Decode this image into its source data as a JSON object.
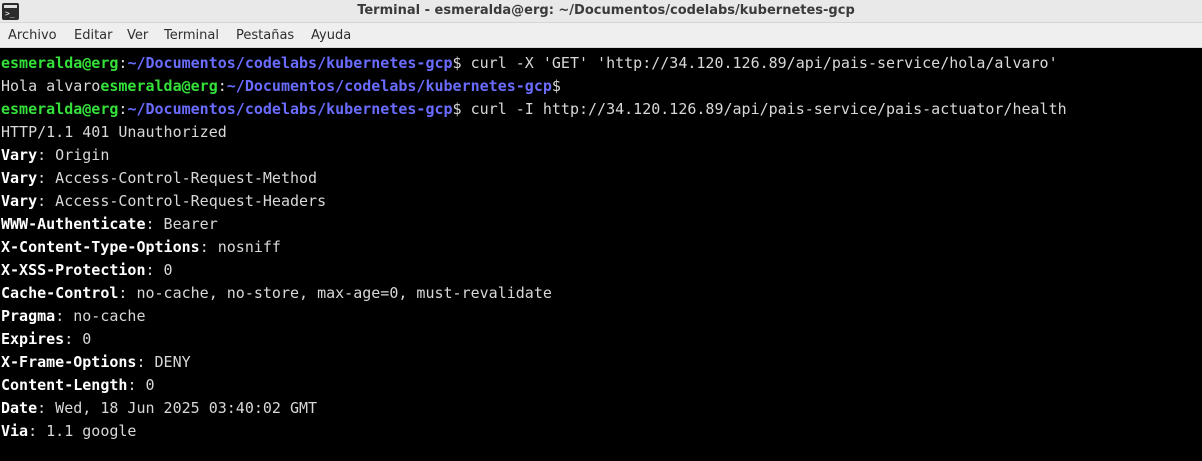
{
  "window": {
    "title": "Terminal - esmeralda@erg: ~/Documentos/codelabs/kubernetes-gcp",
    "icon": "terminal-app-icon"
  },
  "menubar": {
    "items": [
      "Archivo",
      "Editar",
      "Ver",
      "Terminal",
      "Pestañas",
      "Ayuda"
    ]
  },
  "prompt": {
    "user_host": "esmeralda@erg",
    "colon": ":",
    "path": "~/Documentos/codelabs/kubernetes-gcp",
    "dollar": "$"
  },
  "colors": {
    "background": "#000000",
    "prompt_user": "#34e03a",
    "prompt_path": "#6a6cff",
    "text": "#d8d8d8"
  },
  "terminal": {
    "cmd1": " curl -X 'GET' 'http://34.120.126.89/api/pais-service/hola/alvaro'",
    "output1": "Hola alvaro",
    "cmd2": "",
    "cmd3": " curl -I http://34.120.126.89/api/pais-service/pais-actuator/health",
    "status_line": "HTTP/1.1 401 Unauthorized",
    "headers": [
      {
        "key": "Vary",
        "value": ": Origin"
      },
      {
        "key": "Vary",
        "value": ": Access-Control-Request-Method"
      },
      {
        "key": "Vary",
        "value": ": Access-Control-Request-Headers"
      },
      {
        "key": "WWW-Authenticate",
        "value": ": Bearer"
      },
      {
        "key": "X-Content-Type-Options",
        "value": ": nosniff"
      },
      {
        "key": "X-XSS-Protection",
        "value": ": 0"
      },
      {
        "key": "Cache-Control",
        "value": ": no-cache, no-store, max-age=0, must-revalidate"
      },
      {
        "key": "Pragma",
        "value": ": no-cache"
      },
      {
        "key": "Expires",
        "value": ": 0"
      },
      {
        "key": "X-Frame-Options",
        "value": ": DENY"
      },
      {
        "key": "Content-Length",
        "value": ": 0"
      },
      {
        "key": "Date",
        "value": ": Wed, 18 Jun 2025 03:40:02 GMT"
      },
      {
        "key": "Via",
        "value": ": 1.1 google"
      }
    ]
  }
}
